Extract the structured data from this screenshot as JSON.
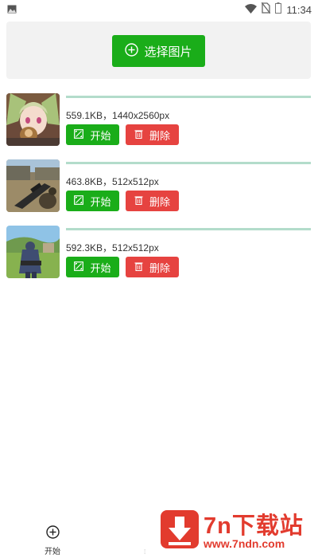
{
  "status_bar": {
    "time": "11:34"
  },
  "select_button": {
    "label": "选择图片"
  },
  "images": [
    {
      "info": "559.1KB，1440x2560px",
      "start_label": "开始",
      "delete_label": "删除",
      "progress": 1.0,
      "thumb": "anime-character"
    },
    {
      "info": "463.8KB，512x512px",
      "start_label": "开始",
      "delete_label": "删除",
      "progress": 1.0,
      "thumb": "shooter-game-sniper"
    },
    {
      "info": "592.3KB，512x512px",
      "start_label": "开始",
      "delete_label": "删除",
      "progress": 1.0,
      "thumb": "shooter-game-field"
    }
  ],
  "tabbar": {
    "start_label": "开始"
  },
  "watermark": {
    "title": "7n下载站",
    "url": "www.7ndn.com"
  },
  "colors": {
    "green": "#1aad19",
    "red": "#e64340",
    "progress": "#b3dccb",
    "watermark": "#e23b2e"
  }
}
